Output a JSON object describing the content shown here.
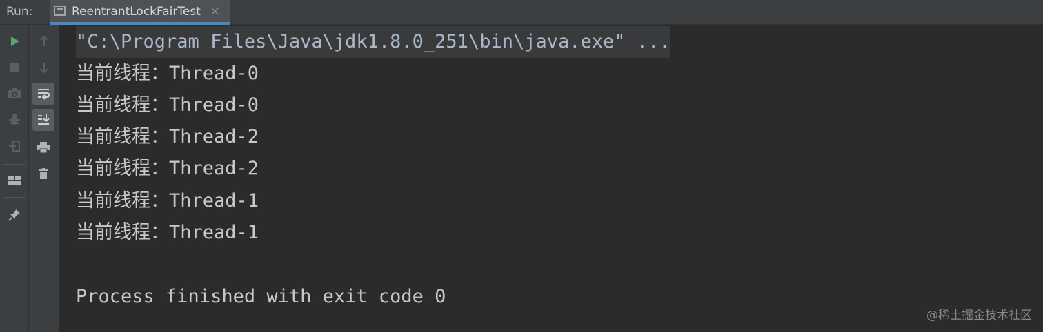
{
  "header": {
    "run_label": "Run:",
    "tab_title": "ReentrantLockFairTest",
    "tab_close": "×"
  },
  "toolbar_left": {
    "buttons": [
      "run-icon",
      "stop-icon",
      "camera-icon",
      "debug-bug-icon",
      "exit-icon",
      "layout-icon",
      "pin-icon"
    ]
  },
  "toolbar_right": {
    "buttons": [
      "up-arrow-icon",
      "down-arrow-icon",
      "soft-wrap-icon",
      "scroll-to-end-icon",
      "print-icon",
      "trash-icon"
    ]
  },
  "console": {
    "command": "\"C:\\Program Files\\Java\\jdk1.8.0_251\\bin\\java.exe\" ...",
    "lines": [
      "当前线程：Thread-0",
      "当前线程：Thread-0",
      "当前线程：Thread-2",
      "当前线程：Thread-2",
      "当前线程：Thread-1",
      "当前线程：Thread-1"
    ],
    "exit_message": "Process finished with exit code 0"
  },
  "watermark": "@稀土掘金技术社区",
  "colors": {
    "background": "#2b2b2b",
    "panel": "#3c3f41",
    "run_green": "#59a869",
    "tab_accent": "#4a88c7"
  }
}
